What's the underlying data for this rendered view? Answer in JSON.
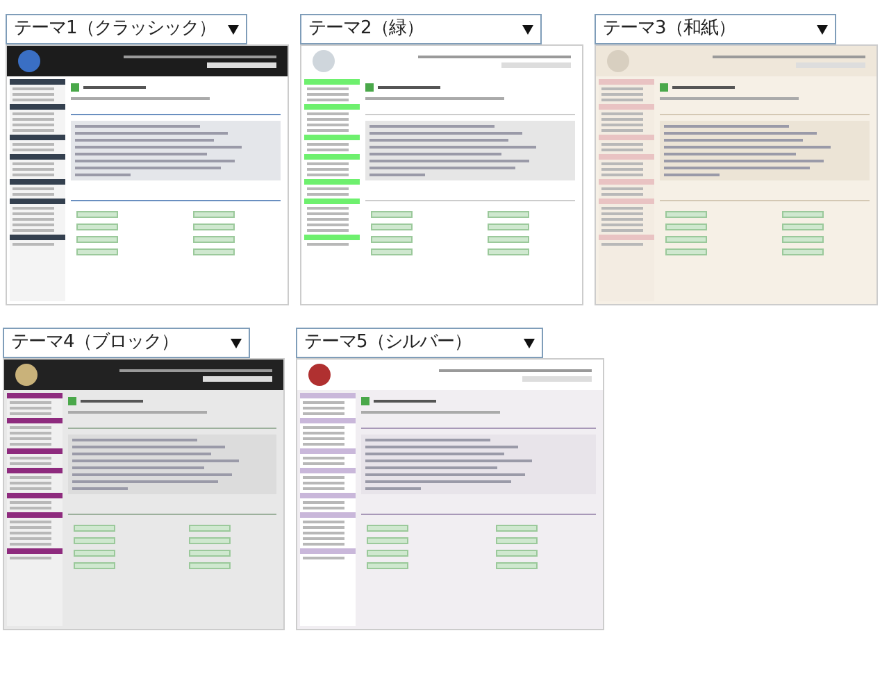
{
  "themes": [
    {
      "label": "テーマ1（クラッシック）",
      "kind": "classic"
    },
    {
      "label": "テーマ2（緑）",
      "kind": "green"
    },
    {
      "label": "テーマ3（和紙）",
      "kind": "washi"
    },
    {
      "label": "テーマ4（ブロック）",
      "kind": "block"
    },
    {
      "label": "テーマ5（シルバー）",
      "kind": "silver"
    }
  ]
}
